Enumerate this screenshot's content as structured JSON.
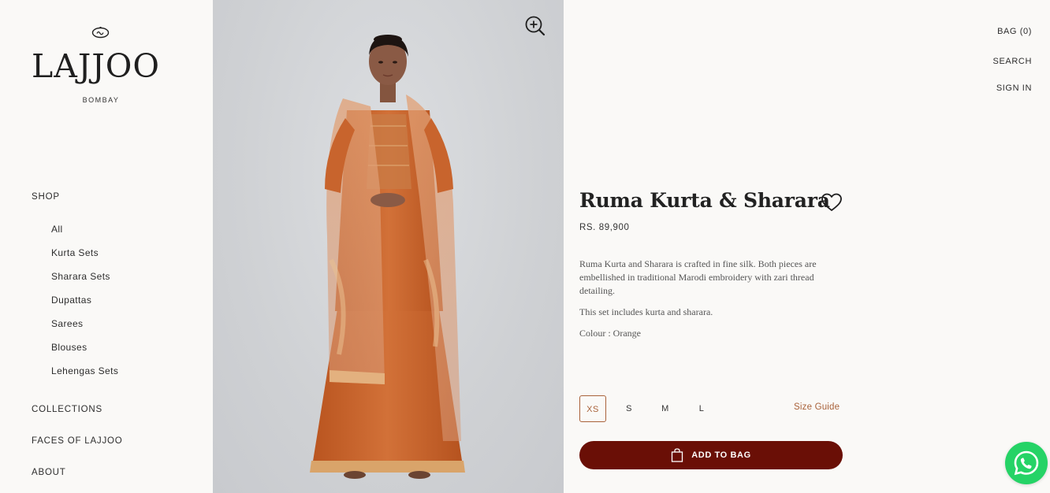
{
  "brand": {
    "name": "LAJJOO",
    "city": "BOMBAY",
    "mark_icon": "lajjoo-monogram-icon"
  },
  "nav": {
    "shop": "SHOP",
    "shop_items": [
      "All",
      "Kurta Sets",
      "Sharara Sets",
      "Dupattas",
      "Sarees",
      "Blouses",
      "Lehengas Sets"
    ],
    "collections": "COLLECTIONS",
    "faces": "FACES OF LAJJOO",
    "about": "ABOUT"
  },
  "header": {
    "bag": "BAG (0)",
    "search": "SEARCH",
    "sign_in": "SIGN IN"
  },
  "product": {
    "title": "Ruma Kurta & Sharara",
    "price": "RS. 89,900",
    "description": "Ruma Kurta and Sharara is crafted in fine silk. Both pieces are embellished in traditional Marodi embroidery with zari thread detailing.",
    "includes": "This set includes kurta and sharara.",
    "colour": "Colour : Orange",
    "sizes": [
      "XS",
      "S",
      "M",
      "L"
    ],
    "selected_size": "XS",
    "size_guide": "Size Guide",
    "add_to_bag": "ADD TO BAG",
    "image_icon": "zoom-in-icon",
    "wishlist_icon": "heart-icon"
  },
  "colors": {
    "accent": "#a9623a",
    "button": "#6a0f06",
    "whatsapp": "#25d366",
    "garment": "#c8652e",
    "background": "#faf9f7"
  },
  "floating": {
    "chat_icon": "whatsapp-icon"
  }
}
